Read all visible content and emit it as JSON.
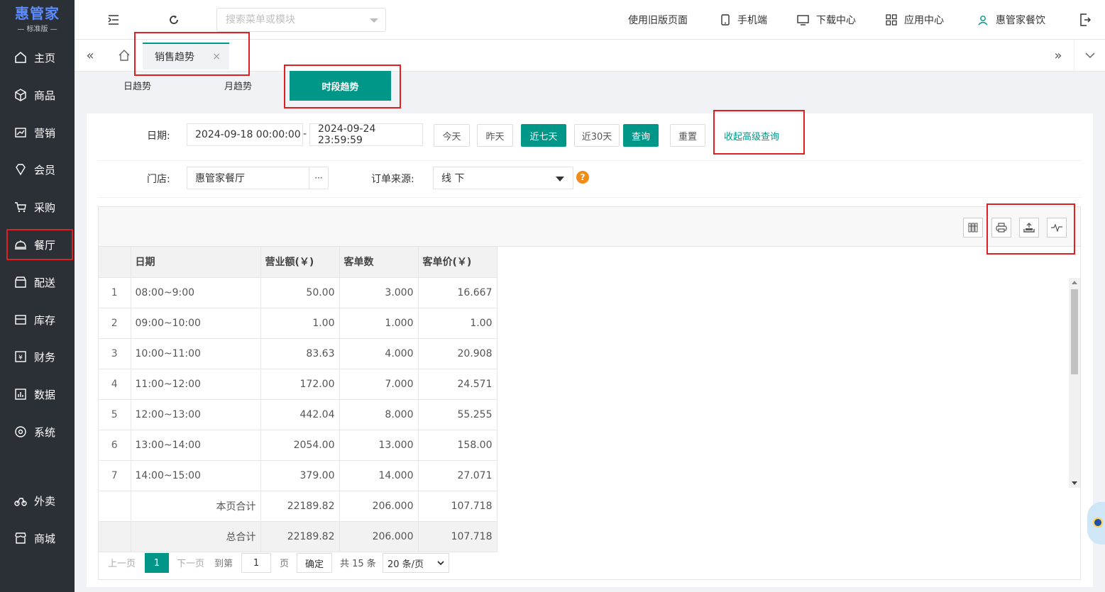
{
  "brand": {
    "name": "惠管家",
    "edition": "— 标准版 —"
  },
  "sidebar": {
    "items": [
      {
        "label": "主页",
        "icon": "home-icon"
      },
      {
        "label": "商品",
        "icon": "box-icon"
      },
      {
        "label": "营销",
        "icon": "chart-icon"
      },
      {
        "label": "会员",
        "icon": "diamond-icon"
      },
      {
        "label": "采购",
        "icon": "cart-icon"
      },
      {
        "label": "餐厅",
        "icon": "cloche-icon"
      },
      {
        "label": "配送",
        "icon": "store-icon"
      },
      {
        "label": "库存",
        "icon": "inventory-icon"
      },
      {
        "label": "财务",
        "icon": "finance-icon"
      },
      {
        "label": "数据",
        "icon": "data-icon"
      },
      {
        "label": "系统",
        "icon": "settings-icon"
      },
      {
        "label": "外卖",
        "icon": "bike-icon"
      },
      {
        "label": "商城",
        "icon": "shop-icon"
      }
    ]
  },
  "topbar": {
    "search_placeholder": "搜索菜单或模块",
    "old_page": "使用旧版页面",
    "mobile": "手机端",
    "download": "下载中心",
    "apps": "应用中心",
    "user": "惠管家餐饮"
  },
  "tabs": {
    "active": "销售趋势"
  },
  "subtabs": {
    "day": "日趋势",
    "month": "月趋势",
    "period": "时段趋势"
  },
  "filters": {
    "date_label": "日期:",
    "date_start": "2024-09-18 00:00:00",
    "date_sep": "-",
    "date_end": "2024-09-24 23:59:59",
    "btn_today": "今天",
    "btn_yesterday": "昨天",
    "btn_7days": "近七天",
    "btn_30days": "近30天",
    "btn_query": "查询",
    "btn_reset": "重置",
    "collapse_link": "收起高级查询",
    "store_label": "门店:",
    "store_value": "惠管家餐厅",
    "store_more": "···",
    "source_label": "订单来源:",
    "source_value": "线 下",
    "help": "?"
  },
  "table": {
    "headers": [
      "日期",
      "营业额(￥)",
      "客单数",
      "客单价(￥)"
    ],
    "rows": [
      [
        "1",
        "08:00~9:00",
        "50.00",
        "3.000",
        "16.667"
      ],
      [
        "2",
        "09:00~10:00",
        "1.00",
        "1.000",
        "1.00"
      ],
      [
        "3",
        "10:00~11:00",
        "83.63",
        "4.000",
        "20.908"
      ],
      [
        "4",
        "11:00~12:00",
        "172.00",
        "7.000",
        "24.571"
      ],
      [
        "5",
        "12:00~13:00",
        "442.04",
        "8.000",
        "55.255"
      ],
      [
        "6",
        "13:00~14:00",
        "2054.00",
        "13.000",
        "158.00"
      ],
      [
        "7",
        "14:00~15:00",
        "379.00",
        "14.000",
        "27.071"
      ]
    ],
    "page_total": [
      "本页合计",
      "22189.82",
      "206.000",
      "107.718"
    ],
    "grand_total": [
      "总合计",
      "22189.82",
      "206.000",
      "107.718"
    ]
  },
  "pager": {
    "prev": "上一页",
    "current": "1",
    "next": "下一页",
    "goto": "到第",
    "goto_value": "1",
    "page_unit": "页",
    "confirm": "确定",
    "total": "共 15 条",
    "page_size": "20 条/页"
  }
}
